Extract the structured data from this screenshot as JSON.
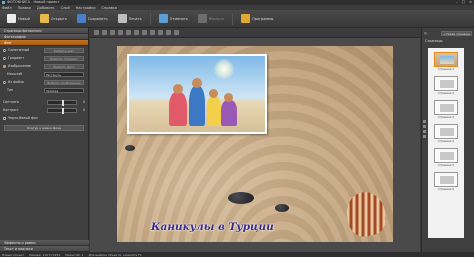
{
  "window": {
    "title": "ФОТОКНИГА - Новый проект"
  },
  "menu": [
    "Файл",
    "Правка",
    "Добавить",
    "Слой",
    "Настройки",
    "Справка"
  ],
  "toolbar": {
    "new": "Новый",
    "open": "Открыть",
    "save": "Сохранить",
    "print": "Печать",
    "undo": "Отменить",
    "redo": "Вернуть",
    "programs": "Программы"
  },
  "left_panel": {
    "section_page_styles": "Страницы фотокниги",
    "section_background": "Фон",
    "tab_active": "Фон",
    "sub_photos": "Фотографии",
    "opt_solid": "Однотонный",
    "btn_choose_color": "Выбрать цвет",
    "opt_gradient": "Градиент",
    "btn_choose_gradient": "Выбрать градиент",
    "opt_image": "Изображение",
    "btn_choose_image": "Выбрать фото",
    "label_placement": "Масштаб",
    "combo_placement": "Растянуть",
    "opt_from_file": "Из файла",
    "btn_choose_file": "Выбрать изображение",
    "label_type": "Тип",
    "combo_type": "Заливка",
    "label_brightness": "Светлота",
    "brightness_value": "0",
    "label_contrast": "Контраст",
    "contrast_value": "0",
    "label_bw": "Черно-белый фон",
    "btn_bg_contour": "Контур и рамка фона",
    "section_effects": "Эффекты и рамки",
    "section_text": "Текст и надписи"
  },
  "canvas": {
    "caption": "Каникулы в Турции"
  },
  "right_panel": {
    "add_page": "+ Новая страница",
    "title": "Страницы",
    "pages": [
      "Страница 1",
      "Страница 2",
      "Страница 3",
      "Страница 4",
      "Страница 5",
      "Страница 6"
    ],
    "selected_index": 0
  },
  "status": [
    "Новый проект",
    "Размер: 1107×1452",
    "Масштаб: 1",
    "Для выбора объекта, нажмите F1"
  ]
}
